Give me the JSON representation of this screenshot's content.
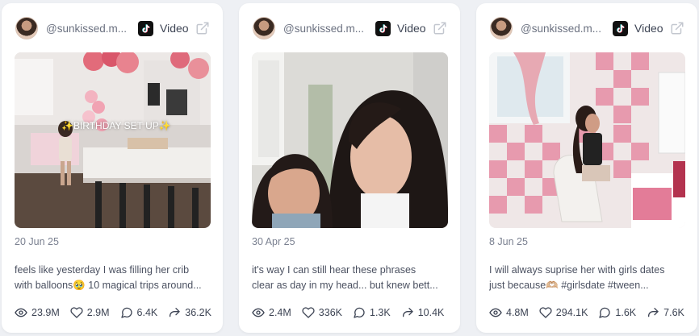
{
  "cards": [
    {
      "handle": "@sunkissed.m...",
      "platform": "Video",
      "overlay_text": "✨BIRTHDAY SET UP✨",
      "date": "20 Jun 25",
      "caption_line1": "feels like yesterday I was filling her crib",
      "caption_line2": "with balloons🥹 10 magical trips around...",
      "views": "23.9M",
      "likes": "2.9M",
      "comments": "6.4K",
      "shares": "36.2K"
    },
    {
      "handle": "@sunkissed.m...",
      "platform": "Video",
      "date": "30 Apr 25",
      "caption_line1": "it's way I can still hear these phrases",
      "caption_line2": "clear as day in my head... but knew bett...",
      "views": "2.4M",
      "likes": "336K",
      "comments": "1.3K",
      "shares": "10.4K"
    },
    {
      "handle": "@sunkissed.m...",
      "platform": "Video",
      "date": "8 Jun 25",
      "caption_line1": "I will always suprise her with girls dates",
      "caption_line2": "just because🫶🏼 #girlsdate #tween...",
      "views": "4.8M",
      "likes": "294.1K",
      "comments": "1.6K",
      "shares": "7.6K"
    }
  ],
  "icons": {
    "platform": "tiktok-icon",
    "external": "external-link-icon",
    "views": "eye-icon",
    "likes": "heart-icon",
    "comments": "comment-icon",
    "shares": "share-icon"
  }
}
